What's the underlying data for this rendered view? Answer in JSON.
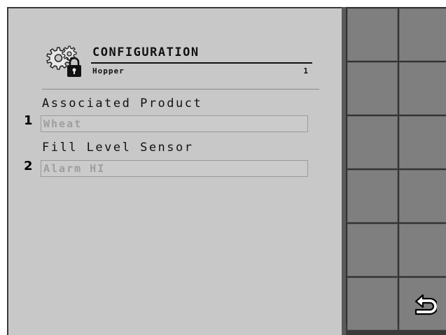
{
  "header": {
    "title": "CONFIGURATION",
    "subtitle": "Hopper",
    "subtitle_number": "1",
    "icon": "gear-lock-icon"
  },
  "fields": [
    {
      "index": "1",
      "label": "Associated Product",
      "value": "Wheat"
    },
    {
      "index": "2",
      "label": "Fill Level Sensor",
      "value": "Alarm HI"
    }
  ],
  "softkeys": {
    "back_icon": "return-arrow-icon"
  },
  "colors": {
    "panel_bg": "#c8c8c8",
    "softkey_bg": "#7f7f7f",
    "frame": "#3a3a3a",
    "field_text": "#9e9e9e"
  }
}
